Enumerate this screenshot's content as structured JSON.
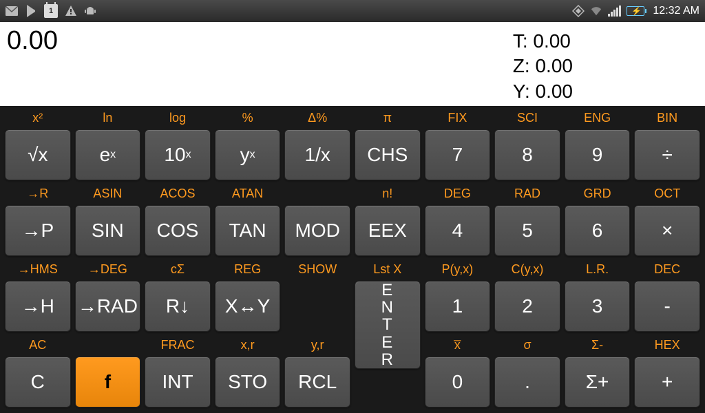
{
  "status": {
    "time": "12:32 AM",
    "icons": {
      "mail": "✉",
      "store": "▶",
      "calendar": "1",
      "warning": "⚠",
      "android": "❖",
      "sync": "◈",
      "wifi": "⬢"
    }
  },
  "display": {
    "main": "0.00",
    "stack": {
      "t": "T: 0.00",
      "z": "Z: 0.00",
      "y": "Y: 0.00"
    }
  },
  "rows": [
    [
      {
        "shift": "x²",
        "label": "√x",
        "name": "sqrt"
      },
      {
        "shift": "ln",
        "label": "eˣ",
        "name": "exp"
      },
      {
        "shift": "log",
        "label": "10ˣ",
        "name": "ten-x"
      },
      {
        "shift": "%",
        "label": "yˣ",
        "name": "y-x"
      },
      {
        "shift": "Δ%",
        "label": "1/x",
        "name": "reciprocal"
      },
      {
        "shift": "π",
        "label": "CHS",
        "name": "chs"
      },
      {
        "shift": "FIX",
        "label": "7",
        "name": "digit-7"
      },
      {
        "shift": "SCI",
        "label": "8",
        "name": "digit-8"
      },
      {
        "shift": "ENG",
        "label": "9",
        "name": "digit-9"
      },
      {
        "shift": "BIN",
        "label": "÷",
        "name": "divide"
      }
    ],
    [
      {
        "shift": "→R",
        "label": "→P",
        "name": "to-polar"
      },
      {
        "shift": "ASIN",
        "label": "SIN",
        "name": "sin"
      },
      {
        "shift": "ACOS",
        "label": "COS",
        "name": "cos"
      },
      {
        "shift": "ATAN",
        "label": "TAN",
        "name": "tan"
      },
      {
        "shift": "",
        "label": "MOD",
        "name": "mod"
      },
      {
        "shift": "n!",
        "label": "EEX",
        "name": "eex"
      },
      {
        "shift": "DEG",
        "label": "4",
        "name": "digit-4"
      },
      {
        "shift": "RAD",
        "label": "5",
        "name": "digit-5"
      },
      {
        "shift": "GRD",
        "label": "6",
        "name": "digit-6"
      },
      {
        "shift": "OCT",
        "label": "×",
        "name": "multiply"
      }
    ],
    [
      {
        "shift": "→HMS",
        "label": "→H",
        "name": "to-h"
      },
      {
        "shift": "→DEG",
        "label": "→RAD",
        "name": "to-rad"
      },
      {
        "shift": "cΣ",
        "label": "R↓",
        "name": "roll-down"
      },
      {
        "shift": "REG",
        "label": "X↔Y",
        "name": "swap-xy"
      },
      {
        "shift": "SHOW",
        "label": "",
        "name": ""
      },
      {
        "shift": "Lst X",
        "label": "ENTER",
        "name": "enter"
      },
      {
        "shift": "P(y,x)",
        "label": "1",
        "name": "digit-1"
      },
      {
        "shift": "C(y,x)",
        "label": "2",
        "name": "digit-2"
      },
      {
        "shift": "L.R.",
        "label": "3",
        "name": "digit-3"
      },
      {
        "shift": "DEC",
        "label": "-",
        "name": "subtract"
      }
    ],
    [
      {
        "shift": "AC",
        "label": "C",
        "name": "clear"
      },
      {
        "shift": "",
        "label": "f",
        "name": "shift-f",
        "orange": true
      },
      {
        "shift": "FRAC",
        "label": "INT",
        "name": "int"
      },
      {
        "shift": "x,r",
        "label": "STO",
        "name": "sto"
      },
      {
        "shift": "y,r",
        "label": "RCL",
        "name": "rcl"
      },
      {
        "shift": "",
        "label": "",
        "name": ""
      },
      {
        "shift": "x̅",
        "label": "0",
        "name": "digit-0"
      },
      {
        "shift": "σ",
        "label": ".",
        "name": "decimal"
      },
      {
        "shift": "Σ-",
        "label": "Σ+",
        "name": "sigma-plus"
      },
      {
        "shift": "HEX",
        "label": "+",
        "name": "add"
      }
    ]
  ]
}
